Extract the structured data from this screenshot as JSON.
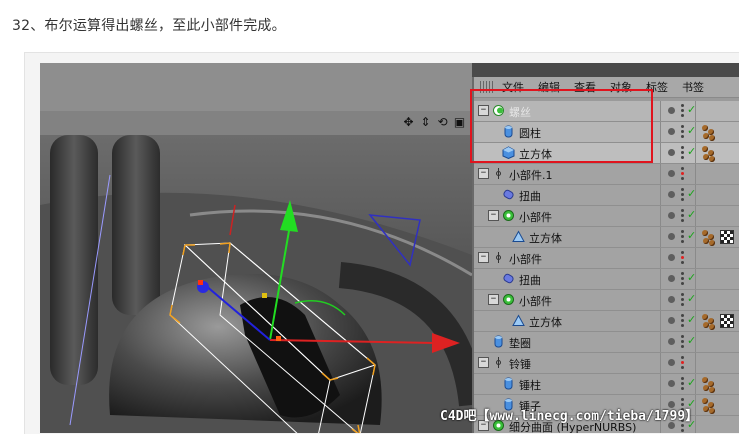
{
  "heading": "32、布尔运算得出螺丝，至此小部件完成。",
  "viewport": {
    "icons": [
      {
        "name": "move-view-icon",
        "glyph": "✥"
      },
      {
        "name": "zoom-view-icon",
        "glyph": "⇕"
      },
      {
        "name": "rotate-view-icon",
        "glyph": "⟲"
      },
      {
        "name": "maximize-view-icon",
        "glyph": "▣"
      }
    ]
  },
  "object_manager": {
    "menu": [
      "文件",
      "编辑",
      "查看",
      "对象",
      "标签",
      "书签"
    ],
    "rows": [
      {
        "label": "螺丝",
        "icon": "boole-icon",
        "indent": 0,
        "tree": "−",
        "dim": true,
        "sel": "sel-a",
        "check": true,
        "tags": ""
      },
      {
        "label": "圆柱",
        "icon": "cylinder-icon",
        "indent": 1,
        "tree": "",
        "dim": false,
        "sel": "sel-a",
        "check": true,
        "tags": "balls"
      },
      {
        "label": "立方体",
        "icon": "cube-icon",
        "indent": 1,
        "tree": "",
        "dim": false,
        "sel": "sel-b",
        "check": true,
        "tags": "balls"
      },
      {
        "label": "小部件.1",
        "icon": "null-icon",
        "indent": 0,
        "tree": "−",
        "dim": false,
        "sel": "",
        "check": false,
        "tags": ""
      },
      {
        "label": "扭曲",
        "icon": "twist-icon",
        "indent": 1,
        "tree": "",
        "dim": false,
        "sel": "",
        "check": true,
        "tags": ""
      },
      {
        "label": "小部件",
        "icon": "hypernurbs-icon",
        "indent": 1,
        "tree": "−",
        "dim": false,
        "sel": "",
        "check": true,
        "tags": ""
      },
      {
        "label": "立方体",
        "icon": "polygon-icon",
        "indent": 2,
        "tree": "",
        "dim": false,
        "sel": "",
        "check": true,
        "tags": "balls+checker"
      },
      {
        "label": "小部件",
        "icon": "null-icon",
        "indent": 0,
        "tree": "−",
        "dim": false,
        "sel": "",
        "check": false,
        "tags": ""
      },
      {
        "label": "扭曲",
        "icon": "twist-icon",
        "indent": 1,
        "tree": "",
        "dim": false,
        "sel": "",
        "check": true,
        "tags": ""
      },
      {
        "label": "小部件",
        "icon": "hypernurbs-icon",
        "indent": 1,
        "tree": "−",
        "dim": false,
        "sel": "",
        "check": true,
        "tags": ""
      },
      {
        "label": "立方体",
        "icon": "polygon-icon",
        "indent": 2,
        "tree": "",
        "dim": false,
        "sel": "",
        "check": true,
        "tags": "balls+checker"
      },
      {
        "label": "垫圈",
        "icon": "cylinder-icon",
        "indent": 0,
        "tree": "",
        "dim": false,
        "sel": "",
        "check": true,
        "tags": ""
      },
      {
        "label": "铃锤",
        "icon": "null-icon",
        "indent": 0,
        "tree": "−",
        "dim": false,
        "sel": "",
        "check": false,
        "tags": ""
      },
      {
        "label": "锤柱",
        "icon": "cylinder-icon",
        "indent": 1,
        "tree": "",
        "dim": false,
        "sel": "",
        "check": true,
        "tags": "balls"
      },
      {
        "label": "锤子",
        "icon": "cylinder-icon",
        "indent": 1,
        "tree": "",
        "dim": false,
        "sel": "",
        "check": true,
        "tags": "balls"
      },
      {
        "label": "细分曲面 (HyperNURBS)",
        "icon": "hypernurbs-icon",
        "indent": 0,
        "tree": "−",
        "dim": false,
        "sel": "",
        "check": true,
        "tags": ""
      }
    ]
  },
  "watermark": "C4D吧【www.linecg.com/tieba/1799】"
}
